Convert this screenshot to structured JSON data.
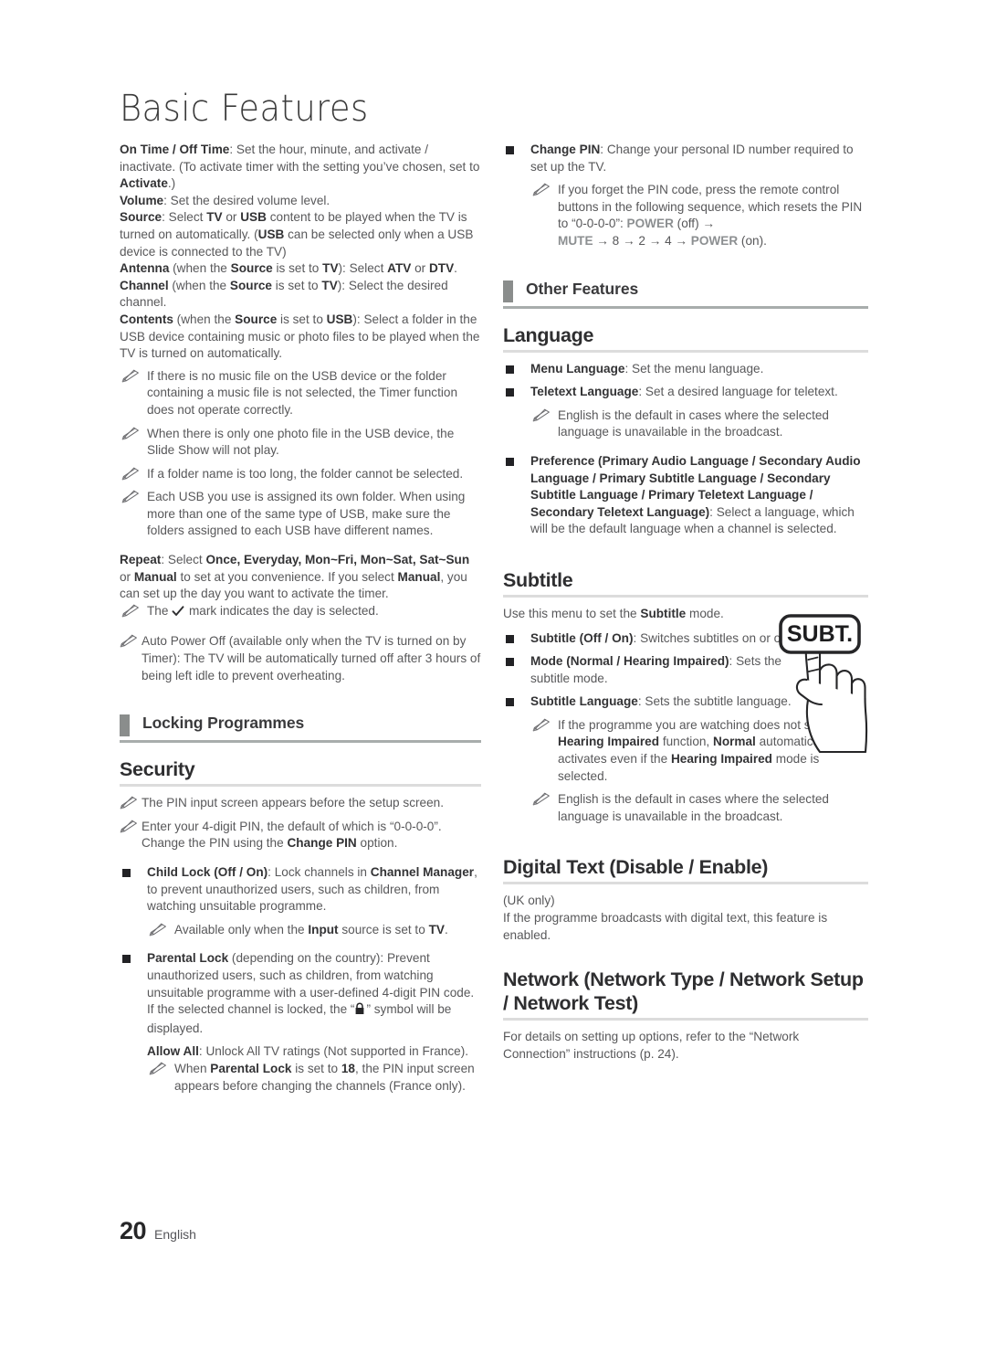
{
  "page": {
    "title": "Basic Features",
    "footer_number": "20",
    "footer_language": "English"
  },
  "icons": {
    "note": "pencil-note-icon",
    "bullet": "black-square-bullet-icon",
    "check": "check-mark-icon",
    "lock": "padlock-icon",
    "subt_button": "subt-remote-button-icon",
    "hand": "pointing-hand-icon"
  },
  "colors": {
    "body_text": "#58585a",
    "bold_text": "#333335",
    "section_tab": "#8a8d8c",
    "section_rule": "#a8adac",
    "heading_rule": "#dcdcdc",
    "gray_key": "#8c8f91",
    "bullet": "#222225"
  },
  "left_column": {
    "timer_settings": {
      "on_off_time_label": "On Time / Off Time",
      "on_off_time_text": ": Set the hour, minute, and activate / inactivate. (To activate timer with the setting you’ve chosen, set to ",
      "on_off_time_bold_tail": "Activate",
      "on_off_time_end": ".)",
      "volume_label": "Volume",
      "volume_text": ": Set the desired volume level.",
      "source_label": "Source",
      "source_text_1": ": Select ",
      "source_tv": "TV",
      "source_or": " or ",
      "source_usb": "USB",
      "source_text_2": " content to be played when the TV is turned on automatically. (",
      "source_usb2": "USB",
      "source_text_3": " can be selected only when a USB device is connected to the TV)",
      "antenna_label": "Antenna",
      "antenna_text_1": " (when the ",
      "antenna_source": "Source",
      "antenna_text_2": " is set to ",
      "antenna_tv": "TV",
      "antenna_text_3": "): Select ",
      "antenna_atv": "ATV",
      "antenna_text_4": " or ",
      "antenna_dtv": "DTV",
      "antenna_text_5": ".",
      "channel_label": "Channel",
      "channel_text_1": " (when the ",
      "channel_source": "Source",
      "channel_text_2": " is set to ",
      "channel_tv": "TV",
      "channel_text_3": "): Select the desired channel.",
      "contents_label": "Contents",
      "contents_text_1": " (when the ",
      "contents_source": "Source",
      "contents_text_2": " is set to ",
      "contents_usb": "USB",
      "contents_text_3": "): Select a folder in the USB device containing music or photo files to be played when the TV is turned on automatically."
    },
    "usb_notes": [
      "If there is no music file on the USB device or the folder containing a music file is not selected, the Timer function does not operate correctly.",
      "When there is only one photo file in the USB device, the Slide Show will not play.",
      "If a folder name is too long, the folder cannot be selected.",
      "Each USB you use is assigned its own folder. When using more than one of the same type of USB, make sure the folders assigned to each USB have different names."
    ],
    "repeat": {
      "label": "Repeat",
      "text_1": ": Select ",
      "options_1": "Once, Everyday, Mon~Fri, Mon~Sat, Sat~Sun",
      "text_2": " or ",
      "manual_1": "Manual",
      "text_3": " to set at you convenience. If you select ",
      "manual_2": "Manual",
      "text_4": ", you can set up the day you want to activate the timer.",
      "note_pre": "The ",
      "note_post": " mark indicates the day is selected."
    },
    "auto_power_off_note": "Auto Power Off (available only when the TV is turned on by Timer): The TV will be automatically turned off after 3 hours of being left idle to prevent overheating.",
    "locking_programmes_header": "Locking Programmes",
    "security_heading": "Security",
    "security_notes": [
      "The PIN input screen appears before the setup screen."
    ],
    "security_pin_note": {
      "text_1": "Enter your 4-digit PIN, the default of which is “0-0-0-0”. Change the PIN using the ",
      "bold": "Change PIN",
      "text_2": " option."
    },
    "child_lock": {
      "label": "Child Lock (Off / On)",
      "text_1": ": Lock channels in ",
      "bold_1": "Channel Manager",
      "text_2": ", to prevent unauthorized users, such as children, from watching unsuitable programme.",
      "note_1": "Available only when the ",
      "note_bold": "Input",
      "note_2": " source is set to ",
      "note_bold_2": "TV",
      "note_3": "."
    },
    "parental_lock": {
      "label": "Parental Lock",
      "text_1": " (depending on the country): Prevent unauthorized users, such as children, from watching unsuitable programme with a user-defined 4-digit PIN code. If the selected channel is locked, the “",
      "text_2": "” symbol will be displayed.",
      "allow_all_label": "Allow All",
      "allow_all_text": ": Unlock All TV ratings (Not supported in France).",
      "note_1": "When ",
      "note_bold_1": "Parental Lock",
      "note_2": " is set to ",
      "note_bold_2": "18",
      "note_3": ", the PIN input screen appears before changing the channels (France only)."
    }
  },
  "right_column": {
    "change_pin": {
      "label": "Change PIN",
      "text": ": Change your personal ID number required to set up the TV.",
      "note_text_1": "If you forget the PIN code, press the remote control buttons in the following sequence, which resets the PIN to “0-0-0-0”: ",
      "note_power_off": "POWER",
      "note_off": " (off) ",
      "note_arrow": "→",
      "note_mute": "MUTE",
      "note_seq": " → 8 → 2 → 4 → ",
      "note_power_on": "POWER",
      "note_on": " (on)."
    },
    "other_features_header": "Other Features",
    "language_heading": "Language",
    "menu_language": {
      "label": "Menu Language",
      "text": ": Set the menu language."
    },
    "teletext_language": {
      "label": "Teletext Language",
      "text": ": Set a desired language for teletext.",
      "note": "English is the default in cases where the selected language is unavailable in the broadcast."
    },
    "preference": {
      "bold": "Preference (Primary Audio Language / Secondary Audio Language / Primary Subtitle Language / Secondary Subtitle Language / Primary Teletext Language / Secondary Teletext Language)",
      "text": ": Select a language, which will be the default language when a channel is selected."
    },
    "subtitle_heading": "Subtitle",
    "subtitle_intro_1": "Use this menu to set the ",
    "subtitle_intro_bold": "Subtitle",
    "subtitle_intro_2": " mode.",
    "subtitle_button_label": "SUBT.",
    "subtitle_items": [
      {
        "label": "Subtitle (Off / On)",
        "text": ": Switches subtitles on or off."
      },
      {
        "label": "Mode (Normal / Hearing Impaired)",
        "text": ": Sets the subtitle mode."
      },
      {
        "label": "Subtitle Language",
        "text": ": Sets the subtitle language."
      }
    ],
    "subtitle_notes": {
      "note1_1": "If the programme you are watching does not support the ",
      "note1_b1": "Hearing Impaired",
      "note1_2": " function, ",
      "note1_b2": "Normal",
      "note1_3": " automatically activates even if the ",
      "note1_b3": "Hearing Impaired",
      "note1_4": " mode is selected.",
      "note2": "English is the default in cases where the selected language is unavailable in the broadcast."
    },
    "digital_text_heading": "Digital Text (Disable / Enable)",
    "digital_text_uk": "(UK only)",
    "digital_text_body": "If the programme broadcasts with digital text, this feature is enabled.",
    "network_heading": "Network (Network Type / Network Setup / Network Test)",
    "network_body": "For details on setting up options, refer to the “Network Connection” instructions (p. 24)."
  }
}
